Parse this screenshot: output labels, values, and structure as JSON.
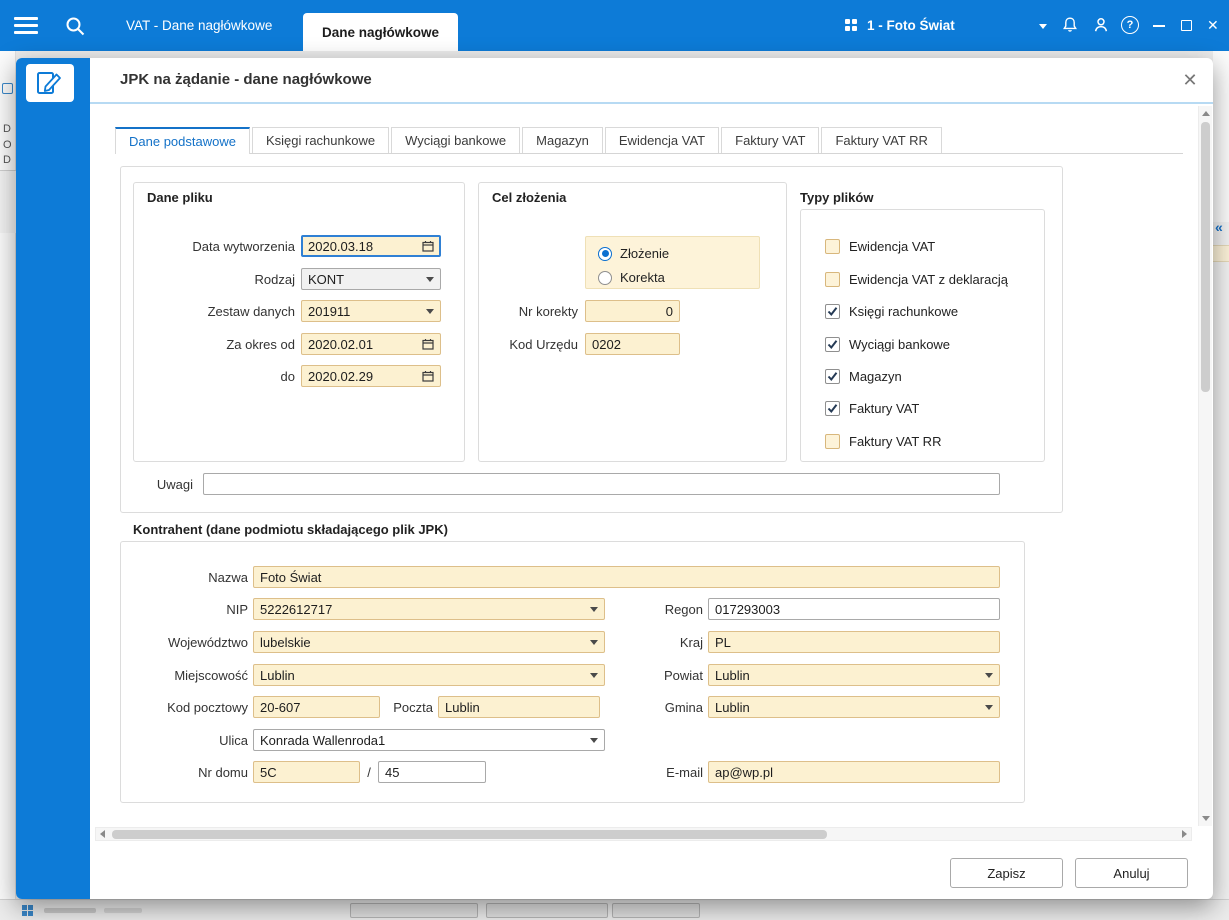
{
  "colors": {
    "topbar_blue": "#0d7bd7",
    "accent_blue": "#1472c8",
    "field_cream": "#fcf1d1",
    "field_cream_border": "#ddbf8a"
  },
  "icons": {
    "help": "?",
    "close": "✕",
    "collapse_chevrons": "«"
  },
  "topbar": {
    "tab_background": "VAT - Dane nagłówkowe",
    "tab_active": "Dane nagłówkowe",
    "company_selector": "1 - Foto Świat"
  },
  "background": {
    "left_fragments": [
      "D",
      "O",
      "D"
    ]
  },
  "dialog": {
    "title": "JPK na żądanie - dane nagłówkowe",
    "tabs": [
      {
        "label": "Dane podstawowe",
        "active": true
      },
      {
        "label": "Księgi rachunkowe",
        "active": false
      },
      {
        "label": "Wyciągi bankowe",
        "active": false
      },
      {
        "label": "Magazyn",
        "active": false
      },
      {
        "label": "Ewidencja VAT",
        "active": false
      },
      {
        "label": "Faktury VAT",
        "active": false
      },
      {
        "label": "Faktury VAT RR",
        "active": false
      }
    ],
    "dane_pliku": {
      "legend": "Dane pliku",
      "data_wytworzenia": {
        "label": "Data wytworzenia",
        "value": "2020.03.18"
      },
      "rodzaj": {
        "label": "Rodzaj",
        "value": "KONT"
      },
      "zestaw_danych": {
        "label": "Zestaw danych",
        "value": "201911"
      },
      "za_okres_od": {
        "label": "Za okres od",
        "value": "2020.02.01"
      },
      "do": {
        "label": "do",
        "value": "2020.02.29"
      }
    },
    "cel_zlozenia": {
      "legend": "Cel złożenia",
      "radio_zlozenie": {
        "label": "Złożenie",
        "selected": true
      },
      "radio_korekta": {
        "label": "Korekta",
        "selected": false
      },
      "nr_korekty": {
        "label": "Nr korekty",
        "value": "0"
      },
      "kod_urzedu": {
        "label": "Kod Urzędu",
        "value": "0202"
      }
    },
    "typy_plikow": {
      "legend": "Typy plików",
      "items": [
        {
          "label": "Ewidencja VAT",
          "checked": false
        },
        {
          "label": "Ewidencja VAT z deklaracją",
          "checked": false
        },
        {
          "label": "Księgi rachunkowe",
          "checked": true
        },
        {
          "label": "Wyciągi bankowe",
          "checked": true
        },
        {
          "label": "Magazyn",
          "checked": true
        },
        {
          "label": "Faktury VAT",
          "checked": true
        },
        {
          "label": "Faktury VAT RR",
          "checked": false
        }
      ]
    },
    "uwagi": {
      "label": "Uwagi",
      "value": ""
    },
    "kontrahent": {
      "legend": "Kontrahent (dane podmiotu składającego plik JPK)",
      "nazwa": {
        "label": "Nazwa",
        "value": "Foto Świat"
      },
      "nip": {
        "label": "NIP",
        "value": "5222612717"
      },
      "regon": {
        "label": "Regon",
        "value": "017293003"
      },
      "wojewodztwo": {
        "label": "Województwo",
        "value": "lubelskie"
      },
      "kraj": {
        "label": "Kraj",
        "value": "PL"
      },
      "miejscowosc": {
        "label": "Miejscowość",
        "value": "Lublin"
      },
      "powiat": {
        "label": "Powiat",
        "value": "Lublin"
      },
      "kod_pocztowy": {
        "label": "Kod pocztowy",
        "value": "20-607"
      },
      "poczta": {
        "label": "Poczta",
        "value": "Lublin"
      },
      "gmina": {
        "label": "Gmina",
        "value": "Lublin"
      },
      "ulica": {
        "label": "Ulica",
        "value": "Konrada Wallenroda1"
      },
      "nr_domu": {
        "label": "Nr domu",
        "value": "5C"
      },
      "nr_domu_separator": "/",
      "nr_lokalu": {
        "value": "45"
      },
      "email": {
        "label": "E-mail",
        "value": "ap@wp.pl"
      }
    },
    "buttons": {
      "save": "Zapisz",
      "cancel": "Anuluj"
    }
  }
}
